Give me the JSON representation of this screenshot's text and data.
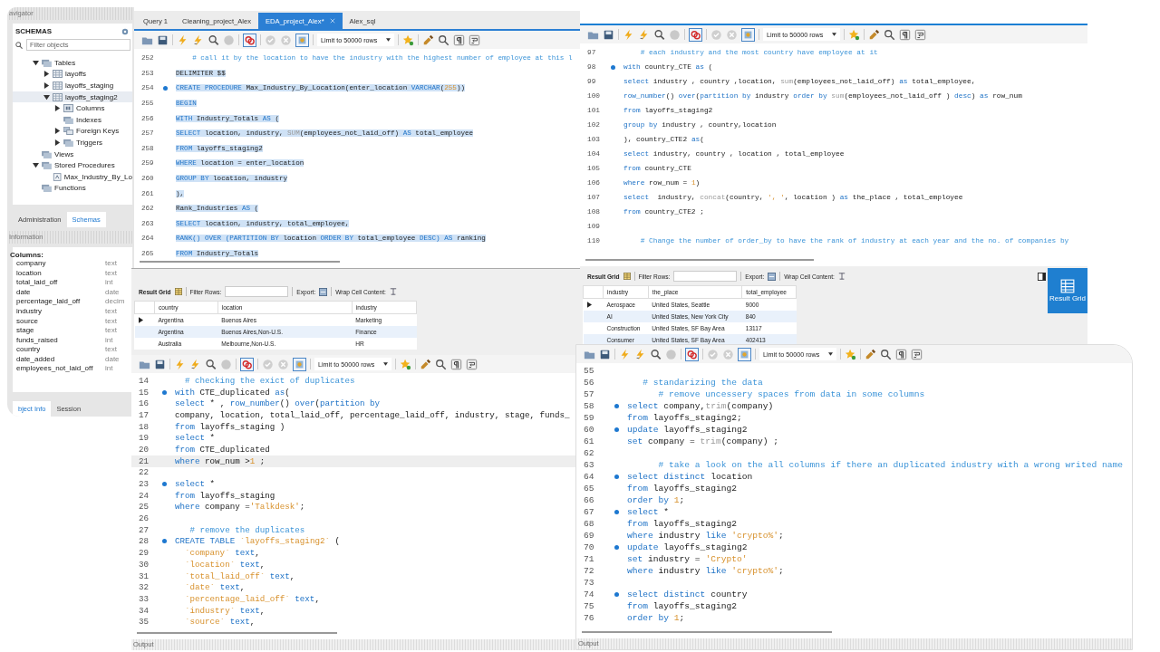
{
  "navigator": {
    "title": "avigator",
    "schemas_label": "SCHEMAS",
    "filter_placeholder": "Filter objects",
    "tree": [
      {
        "label": "Tables",
        "kind": "folder",
        "expanded": true,
        "selected": false,
        "children": [
          {
            "label": "layoffs",
            "kind": "table",
            "expanded": false,
            "selected": false
          },
          {
            "label": "layoffs_staging",
            "kind": "table",
            "expanded": false,
            "selected": false
          },
          {
            "label": "layoffs_staging2",
            "kind": "table",
            "expanded": true,
            "selected": true,
            "children": [
              {
                "label": "Columns",
                "kind": "columns",
                "expanded": false,
                "selected": false
              },
              {
                "label": "Indexes",
                "kind": "folder",
                "selected": false
              },
              {
                "label": "Foreign Keys",
                "kind": "keys",
                "expanded": false,
                "selected": false
              },
              {
                "label": "Triggers",
                "kind": "folder",
                "expanded": false,
                "selected": false
              }
            ]
          }
        ]
      },
      {
        "label": "Views",
        "kind": "folder",
        "selected": false
      },
      {
        "label": "Stored Procedures",
        "kind": "folder",
        "expanded": true,
        "selected": false,
        "children": [
          {
            "label": "Max_Industry_By_Lo",
            "kind": "procedure",
            "selected": false
          }
        ]
      },
      {
        "label": "Functions",
        "kind": "folder",
        "selected": false
      }
    ],
    "tabs": [
      {
        "label": "Administration",
        "selected": false
      },
      {
        "label": "Schemas",
        "selected": true
      }
    ],
    "information": {
      "title": "Information",
      "heading": "Columns:",
      "columns": [
        {
          "name": "company",
          "type": "text"
        },
        {
          "name": "location",
          "type": "text"
        },
        {
          "name": "total_laid_off",
          "type": "int"
        },
        {
          "name": "date",
          "type": "date"
        },
        {
          "name": "percentage_laid_off",
          "type": "decim"
        },
        {
          "name": "industry",
          "type": "text"
        },
        {
          "name": "source",
          "type": "text"
        },
        {
          "name": "stage",
          "type": "text"
        },
        {
          "name": "funds_raised",
          "type": "int"
        },
        {
          "name": "country",
          "type": "text"
        },
        {
          "name": "date_added",
          "type": "date"
        },
        {
          "name": "employees_not_laid_off",
          "type": "int"
        }
      ]
    },
    "bottom_tabs": [
      {
        "label": "bject Info",
        "selected": true
      },
      {
        "label": "Session",
        "selected": false
      }
    ]
  },
  "editors": [
    {
      "tabs": [
        {
          "label": "Query 1",
          "selected": false
        },
        {
          "label": "Cleaning_project_Alex",
          "selected": false
        },
        {
          "label": "EDA_project_Alex*",
          "selected": true
        },
        {
          "label": "Alex_sql",
          "selected": false
        }
      ],
      "toolbar": {
        "limit": "Limit to 50000 rows"
      },
      "lines": [
        {
          "number": "252",
          "dot": false,
          "selected": false,
          "tokens": [
            {
              "kind": "comment",
              "text": "    # call it by the location to have the industry with the highest number of employee at this l"
            }
          ]
        },
        {
          "number": "253",
          "dot": false,
          "selected": true,
          "tokens": [
            {
              "kind": "plain",
              "text": "DELIMITER $$"
            }
          ]
        },
        {
          "number": "254",
          "dot": true,
          "selected": true,
          "tokens": [
            {
              "kind": "keyword",
              "text": "CREATE PROCEDURE "
            },
            {
              "kind": "plain",
              "text": "Max_Industry_By_Location(enter_location "
            },
            {
              "kind": "keyword",
              "text": "VARCHAR"
            },
            {
              "kind": "plain",
              "text": "("
            },
            {
              "kind": "number",
              "text": "255"
            },
            {
              "kind": "plain",
              "text": "))"
            }
          ]
        },
        {
          "number": "255",
          "dot": false,
          "selected": true,
          "tokens": [
            {
              "kind": "keyword",
              "text": "BEGIN"
            }
          ]
        },
        {
          "number": "256",
          "dot": false,
          "selected": true,
          "tokens": [
            {
              "kind": "keyword",
              "text": "WITH "
            },
            {
              "kind": "plain",
              "text": "Industry_Totals "
            },
            {
              "kind": "keyword",
              "text": "AS "
            },
            {
              "kind": "plain",
              "text": "("
            }
          ]
        },
        {
          "number": "257",
          "dot": false,
          "selected": true,
          "tokens": [
            {
              "kind": "keyword",
              "text": "SELECT "
            },
            {
              "kind": "plain",
              "text": "location, industry, "
            },
            {
              "kind": "function",
              "text": "SUM"
            },
            {
              "kind": "plain",
              "text": "(employees_not_laid_off) "
            },
            {
              "kind": "keyword",
              "text": "AS "
            },
            {
              "kind": "plain",
              "text": "total_employee"
            }
          ]
        },
        {
          "number": "258",
          "dot": false,
          "selected": true,
          "tokens": [
            {
              "kind": "keyword",
              "text": "FROM "
            },
            {
              "kind": "plain",
              "text": "layoffs_staging2"
            }
          ]
        },
        {
          "number": "259",
          "dot": false,
          "selected": true,
          "tokens": [
            {
              "kind": "keyword",
              "text": "WHERE "
            },
            {
              "kind": "plain",
              "text": "location = enter_location"
            }
          ]
        },
        {
          "number": "260",
          "dot": false,
          "selected": true,
          "tokens": [
            {
              "kind": "keyword",
              "text": "GROUP BY "
            },
            {
              "kind": "plain",
              "text": "location, industry"
            }
          ]
        },
        {
          "number": "261",
          "dot": false,
          "selected": true,
          "tokens": [
            {
              "kind": "plain",
              "text": "),"
            }
          ]
        },
        {
          "number": "262",
          "dot": false,
          "selected": true,
          "tokens": [
            {
              "kind": "plain",
              "text": "Rank_Industries "
            },
            {
              "kind": "keyword",
              "text": "AS "
            },
            {
              "kind": "plain",
              "text": "("
            }
          ]
        },
        {
          "number": "263",
          "dot": false,
          "selected": true,
          "tokens": [
            {
              "kind": "keyword",
              "text": "SELECT "
            },
            {
              "kind": "plain",
              "text": "location, industry, total_employee,"
            }
          ]
        },
        {
          "number": "264",
          "dot": false,
          "selected": true,
          "tokens": [
            {
              "kind": "keyword",
              "text": "RANK() OVER (PARTITION BY "
            },
            {
              "kind": "plain",
              "text": "location "
            },
            {
              "kind": "keyword",
              "text": "ORDER BY "
            },
            {
              "kind": "plain",
              "text": "total_employee "
            },
            {
              "kind": "keyword",
              "text": "DESC) AS "
            },
            {
              "kind": "plain",
              "text": "ranking"
            }
          ]
        },
        {
          "number": "265",
          "dot": false,
          "selected": true,
          "tokens": [
            {
              "kind": "keyword",
              "text": "FROM "
            },
            {
              "kind": "plain",
              "text": "Industry_Totals"
            }
          ]
        }
      ]
    },
    {
      "toolbar": {
        "limit": "Limit to 50000 rows"
      },
      "lines": [
        {
          "number": "97",
          "dot": false,
          "tokens": [
            {
              "kind": "comment",
              "text": "    # each industry and the most country have employee at it"
            }
          ]
        },
        {
          "number": "98",
          "dot": true,
          "tokens": [
            {
              "kind": "keyword",
              "text": "with "
            },
            {
              "kind": "plain",
              "text": "country_CTE "
            },
            {
              "kind": "keyword",
              "text": "as "
            },
            {
              "kind": "plain",
              "text": "("
            }
          ]
        },
        {
          "number": "99",
          "dot": false,
          "tokens": [
            {
              "kind": "keyword",
              "text": "select "
            },
            {
              "kind": "plain",
              "text": "industry , country ,location, "
            },
            {
              "kind": "function",
              "text": "sum"
            },
            {
              "kind": "plain",
              "text": "(employees_not_laid_off) "
            },
            {
              "kind": "keyword",
              "text": "as "
            },
            {
              "kind": "plain",
              "text": "total_employee,"
            }
          ]
        },
        {
          "number": "100",
          "dot": false,
          "tokens": [
            {
              "kind": "keyword",
              "text": "row_number"
            },
            {
              "kind": "plain",
              "text": "() "
            },
            {
              "kind": "keyword",
              "text": "over"
            },
            {
              "kind": "plain",
              "text": "("
            },
            {
              "kind": "keyword",
              "text": "partition by "
            },
            {
              "kind": "plain",
              "text": "industry "
            },
            {
              "kind": "keyword",
              "text": "order by "
            },
            {
              "kind": "function",
              "text": "sum"
            },
            {
              "kind": "plain",
              "text": "(employees_not_laid_off ) "
            },
            {
              "kind": "keyword",
              "text": "desc"
            },
            {
              "kind": "plain",
              "text": ") "
            },
            {
              "kind": "keyword",
              "text": "as "
            },
            {
              "kind": "plain",
              "text": "row_num"
            }
          ]
        },
        {
          "number": "101",
          "dot": false,
          "tokens": [
            {
              "kind": "keyword",
              "text": "from "
            },
            {
              "kind": "plain",
              "text": "layoffs_staging2"
            }
          ]
        },
        {
          "number": "102",
          "dot": false,
          "tokens": [
            {
              "kind": "keyword",
              "text": "group by "
            },
            {
              "kind": "plain",
              "text": "industry , country,location"
            }
          ]
        },
        {
          "number": "103",
          "dot": false,
          "tokens": [
            {
              "kind": "plain",
              "text": "), country_CTE2 "
            },
            {
              "kind": "keyword",
              "text": "as"
            },
            {
              "kind": "plain",
              "text": "("
            }
          ]
        },
        {
          "number": "104",
          "dot": false,
          "tokens": [
            {
              "kind": "keyword",
              "text": "select "
            },
            {
              "kind": "plain",
              "text": "industry, country , location , total_employee"
            }
          ]
        },
        {
          "number": "105",
          "dot": false,
          "tokens": [
            {
              "kind": "keyword",
              "text": "from "
            },
            {
              "kind": "plain",
              "text": "country_CTE"
            }
          ]
        },
        {
          "number": "106",
          "dot": false,
          "tokens": [
            {
              "kind": "keyword",
              "text": "where "
            },
            {
              "kind": "plain",
              "text": "row_num = "
            },
            {
              "kind": "number",
              "text": "1"
            },
            {
              "kind": "plain",
              "text": ")"
            }
          ]
        },
        {
          "number": "107",
          "dot": false,
          "tokens": [
            {
              "kind": "keyword",
              "text": "select  "
            },
            {
              "kind": "plain",
              "text": "industry, "
            },
            {
              "kind": "function",
              "text": "concat"
            },
            {
              "kind": "plain",
              "text": "(country, "
            },
            {
              "kind": "string",
              "text": "', '"
            },
            {
              "kind": "plain",
              "text": ", location ) "
            },
            {
              "kind": "keyword",
              "text": "as "
            },
            {
              "kind": "plain",
              "text": "the_place , total_employee"
            }
          ]
        },
        {
          "number": "108",
          "dot": false,
          "tokens": [
            {
              "kind": "keyword",
              "text": "from "
            },
            {
              "kind": "plain",
              "text": "country_CTE2 ;"
            }
          ]
        },
        {
          "number": "109",
          "dot": false
        },
        {
          "number": "110",
          "dot": false,
          "tokens": [
            {
              "kind": "comment",
              "text": "    # Change the number of order_by to have the rank of industry at each year and the no. of companies by"
            }
          ]
        }
      ]
    },
    {
      "toolbar": {
        "limit": "Limit to 50000 rows"
      },
      "output": "Output",
      "lines": [
        {
          "number": "14",
          "dot": false,
          "current": false,
          "tokens": [
            {
              "kind": "comment",
              "text": "  # checking the exict of duplicates"
            }
          ]
        },
        {
          "number": "15",
          "dot": true,
          "current": false,
          "tokens": [
            {
              "kind": "keyword",
              "text": "with "
            },
            {
              "kind": "plain",
              "text": "CTE_duplicated "
            },
            {
              "kind": "keyword",
              "text": "as"
            },
            {
              "kind": "plain",
              "text": "("
            }
          ]
        },
        {
          "number": "16",
          "dot": false,
          "current": false,
          "tokens": [
            {
              "kind": "keyword",
              "text": "select "
            },
            {
              "kind": "plain",
              "text": "* , "
            },
            {
              "kind": "keyword",
              "text": "row_number"
            },
            {
              "kind": "plain",
              "text": "() "
            },
            {
              "kind": "keyword",
              "text": "over"
            },
            {
              "kind": "plain",
              "text": "("
            },
            {
              "kind": "keyword",
              "text": "partition by"
            }
          ]
        },
        {
          "number": "17",
          "dot": false,
          "current": false,
          "tokens": [
            {
              "kind": "plain",
              "text": "company, location, total_laid_off, percentage_laid_off, industry, stage, funds_"
            }
          ]
        },
        {
          "number": "18",
          "dot": false,
          "current": false,
          "tokens": [
            {
              "kind": "keyword",
              "text": "from "
            },
            {
              "kind": "plain",
              "text": "layoffs_staging )"
            }
          ]
        },
        {
          "number": "19",
          "dot": false,
          "current": false,
          "tokens": [
            {
              "kind": "keyword",
              "text": "select "
            },
            {
              "kind": "plain",
              "text": "*"
            }
          ]
        },
        {
          "number": "20",
          "dot": false,
          "current": false,
          "tokens": [
            {
              "kind": "keyword",
              "text": "from "
            },
            {
              "kind": "plain",
              "text": "CTE_duplicated"
            }
          ]
        },
        {
          "number": "21",
          "dot": false,
          "current": true,
          "tokens": [
            {
              "kind": "keyword",
              "text": "where "
            },
            {
              "kind": "plain",
              "text": "row_num >"
            },
            {
              "kind": "number",
              "text": "1"
            },
            {
              "kind": "plain",
              "text": " ;"
            }
          ]
        },
        {
          "number": "22",
          "dot": false,
          "current": false
        },
        {
          "number": "23",
          "dot": true,
          "current": false,
          "tokens": [
            {
              "kind": "keyword",
              "text": "select "
            },
            {
              "kind": "plain",
              "text": "*"
            }
          ]
        },
        {
          "number": "24",
          "dot": false,
          "current": false,
          "tokens": [
            {
              "kind": "keyword",
              "text": "from "
            },
            {
              "kind": "plain",
              "text": "layoffs_staging"
            }
          ]
        },
        {
          "number": "25",
          "dot": false,
          "current": false,
          "tokens": [
            {
              "kind": "keyword",
              "text": "where "
            },
            {
              "kind": "plain",
              "text": "company ="
            },
            {
              "kind": "string",
              "text": "'Talkdesk'"
            },
            {
              "kind": "plain",
              "text": ";"
            }
          ]
        },
        {
          "number": "26",
          "dot": false,
          "current": false
        },
        {
          "number": "27",
          "dot": false,
          "current": false,
          "tokens": [
            {
              "kind": "comment",
              "text": "   # remove the duplicates"
            }
          ]
        },
        {
          "number": "28",
          "dot": true,
          "current": false,
          "tokens": [
            {
              "kind": "keyword",
              "text": "CREATE TABLE "
            },
            {
              "kind": "string",
              "text": "`layoffs_staging2`"
            },
            {
              "kind": "plain",
              "text": " ("
            }
          ]
        },
        {
          "number": "29",
          "dot": false,
          "current": false,
          "tokens": [
            {
              "kind": "string",
              "text": "  `company` "
            },
            {
              "kind": "keyword",
              "text": "text"
            },
            {
              "kind": "plain",
              "text": ","
            }
          ]
        },
        {
          "number": "30",
          "dot": false,
          "current": false,
          "tokens": [
            {
              "kind": "string",
              "text": "  `location` "
            },
            {
              "kind": "keyword",
              "text": "text"
            },
            {
              "kind": "plain",
              "text": ","
            }
          ]
        },
        {
          "number": "31",
          "dot": false,
          "current": false,
          "tokens": [
            {
              "kind": "string",
              "text": "  `total_laid_off` "
            },
            {
              "kind": "keyword",
              "text": "text"
            },
            {
              "kind": "plain",
              "text": ","
            }
          ]
        },
        {
          "number": "32",
          "dot": false,
          "current": false,
          "tokens": [
            {
              "kind": "string",
              "text": "  `date` "
            },
            {
              "kind": "keyword",
              "text": "text"
            },
            {
              "kind": "plain",
              "text": ","
            }
          ]
        },
        {
          "number": "33",
          "dot": false,
          "current": false,
          "tokens": [
            {
              "kind": "string",
              "text": "  `percentage_laid_off` "
            },
            {
              "kind": "keyword",
              "text": "text"
            },
            {
              "kind": "plain",
              "text": ","
            }
          ]
        },
        {
          "number": "34",
          "dot": false,
          "current": false,
          "tokens": [
            {
              "kind": "string",
              "text": "  `industry` "
            },
            {
              "kind": "keyword",
              "text": "text"
            },
            {
              "kind": "plain",
              "text": ","
            }
          ]
        },
        {
          "number": "35",
          "dot": false,
          "current": false,
          "tokens": [
            {
              "kind": "string",
              "text": "  `source` "
            },
            {
              "kind": "keyword",
              "text": "text"
            },
            {
              "kind": "plain",
              "text": ","
            }
          ]
        }
      ]
    },
    {
      "toolbar": {
        "limit": "Limit to 50000 rows"
      },
      "output": "Output",
      "lines": [
        {
          "number": "55",
          "dot": false
        },
        {
          "number": "56",
          "dot": false,
          "tokens": [
            {
              "kind": "comment",
              "text": "   # standarizing the data"
            }
          ]
        },
        {
          "number": "57",
          "dot": false,
          "tokens": [
            {
              "kind": "comment",
              "text": "      # remove uncessery spaces from data in some columns"
            }
          ]
        },
        {
          "number": "58",
          "dot": true,
          "tokens": [
            {
              "kind": "keyword",
              "text": "select "
            },
            {
              "kind": "plain",
              "text": "company,"
            },
            {
              "kind": "function",
              "text": "trim"
            },
            {
              "kind": "plain",
              "text": "(company)"
            }
          ]
        },
        {
          "number": "59",
          "dot": false,
          "tokens": [
            {
              "kind": "keyword",
              "text": "from "
            },
            {
              "kind": "plain",
              "text": "layoffs_staging2;"
            }
          ]
        },
        {
          "number": "60",
          "dot": true,
          "tokens": [
            {
              "kind": "keyword",
              "text": "update "
            },
            {
              "kind": "plain",
              "text": "layoffs_staging2"
            }
          ]
        },
        {
          "number": "61",
          "dot": false,
          "tokens": [
            {
              "kind": "keyword",
              "text": "set "
            },
            {
              "kind": "plain",
              "text": "company = "
            },
            {
              "kind": "function",
              "text": "trim"
            },
            {
              "kind": "plain",
              "text": "(company) ;"
            }
          ]
        },
        {
          "number": "62",
          "dot": false
        },
        {
          "number": "63",
          "dot": false,
          "tokens": [
            {
              "kind": "comment",
              "text": "      # take a look on the all columns if there an duplicated industry with a wrong writed name"
            }
          ]
        },
        {
          "number": "64",
          "dot": true,
          "tokens": [
            {
              "kind": "keyword",
              "text": "select distinct "
            },
            {
              "kind": "plain",
              "text": "location"
            }
          ]
        },
        {
          "number": "65",
          "dot": false,
          "tokens": [
            {
              "kind": "keyword",
              "text": "from "
            },
            {
              "kind": "plain",
              "text": "layoffs_staging2"
            }
          ]
        },
        {
          "number": "66",
          "dot": false,
          "tokens": [
            {
              "kind": "keyword",
              "text": "order by "
            },
            {
              "kind": "number",
              "text": "1"
            },
            {
              "kind": "plain",
              "text": ";"
            }
          ]
        },
        {
          "number": "67",
          "dot": true,
          "tokens": [
            {
              "kind": "keyword",
              "text": "select "
            },
            {
              "kind": "plain",
              "text": "*"
            }
          ]
        },
        {
          "number": "68",
          "dot": false,
          "tokens": [
            {
              "kind": "keyword",
              "text": "from "
            },
            {
              "kind": "plain",
              "text": "layoffs_staging2"
            }
          ]
        },
        {
          "number": "69",
          "dot": false,
          "tokens": [
            {
              "kind": "keyword",
              "text": "where "
            },
            {
              "kind": "plain",
              "text": "industry "
            },
            {
              "kind": "keyword",
              "text": "like "
            },
            {
              "kind": "string",
              "text": "'crypto%'"
            },
            {
              "kind": "plain",
              "text": ";"
            }
          ]
        },
        {
          "number": "70",
          "dot": true,
          "tokens": [
            {
              "kind": "keyword",
              "text": "update "
            },
            {
              "kind": "plain",
              "text": "layoffs_staging2"
            }
          ]
        },
        {
          "number": "71",
          "dot": false,
          "tokens": [
            {
              "kind": "keyword",
              "text": "set "
            },
            {
              "kind": "plain",
              "text": "industry = "
            },
            {
              "kind": "string",
              "text": "'Crypto'"
            }
          ]
        },
        {
          "number": "72",
          "dot": false,
          "tokens": [
            {
              "kind": "keyword",
              "text": "where "
            },
            {
              "kind": "plain",
              "text": "industry "
            },
            {
              "kind": "keyword",
              "text": "like "
            },
            {
              "kind": "string",
              "text": "'crypto%'"
            },
            {
              "kind": "plain",
              "text": ";"
            }
          ]
        },
        {
          "number": "73",
          "dot": false
        },
        {
          "number": "74",
          "dot": true,
          "tokens": [
            {
              "kind": "keyword",
              "text": "select distinct "
            },
            {
              "kind": "plain",
              "text": "country"
            }
          ]
        },
        {
          "number": "75",
          "dot": false,
          "tokens": [
            {
              "kind": "keyword",
              "text": "from "
            },
            {
              "kind": "plain",
              "text": "layoffs_staging2"
            }
          ]
        },
        {
          "number": "76",
          "dot": false,
          "tokens": [
            {
              "kind": "keyword",
              "text": "order by "
            },
            {
              "kind": "number",
              "text": "1"
            },
            {
              "kind": "plain",
              "text": ";"
            }
          ]
        }
      ]
    }
  ],
  "result_grids": [
    {
      "tab": "Result Grid",
      "filter_label": "Filter Rows:",
      "export_label": "Export:",
      "wrap_label": "Wrap Cell Content:",
      "columns": [
        "country",
        "location",
        "industry"
      ],
      "rows": [
        {
          "selected": true,
          "cells": [
            "Argentina",
            "Buenos Aires",
            "Marketing"
          ]
        },
        {
          "selected": false,
          "cells": [
            "Argentina",
            "Buenos Aires,Non-U.S.",
            "Finance"
          ]
        },
        {
          "selected": false,
          "cells": [
            "Australia",
            "Melbourne,Non-U.S.",
            "HR"
          ]
        }
      ]
    },
    {
      "tab": "Result Grid",
      "filter_label": "Filter Rows:",
      "export_label": "Export:",
      "wrap_label": "Wrap Cell Content:",
      "side_button": "Result Grid",
      "columns": [
        "industry",
        "the_place",
        "total_employee"
      ],
      "rows": [
        {
          "selected": true,
          "cells": [
            "Aerospace",
            "United States, Seattle",
            "9000"
          ]
        },
        {
          "selected": false,
          "cells": [
            "AI",
            "United States, New York City",
            "840"
          ]
        },
        {
          "selected": false,
          "cells": [
            "Construction",
            "United States, SF Bay Area",
            "13117"
          ]
        },
        {
          "selected": false,
          "cells": [
            "Consumer",
            "United States, SF Bay Area",
            "402413"
          ]
        }
      ]
    }
  ]
}
